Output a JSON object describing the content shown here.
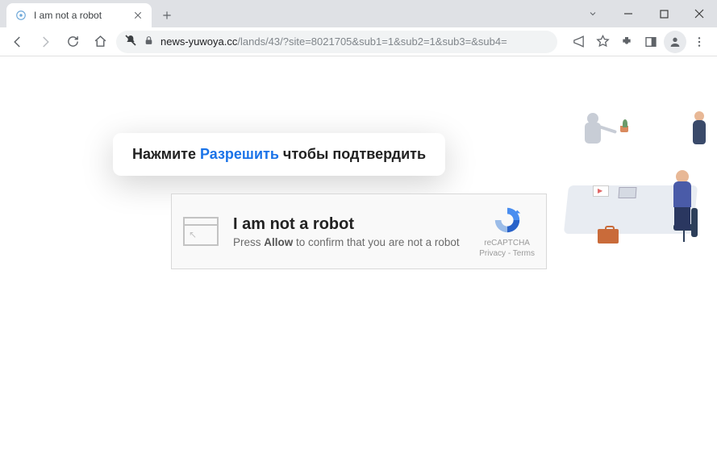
{
  "window": {
    "tab_title": "I am not a robot"
  },
  "toolbar": {
    "url_host": "news-yuwoya.cc",
    "url_rest": "/lands/43/?site=8021705&sub1=1&sub2=1&sub3=&sub4="
  },
  "page": {
    "bubble_prefix": "Нажмите ",
    "bubble_allow": "Разрешить",
    "bubble_suffix": " чтобы подтвердить",
    "rc_title": "I am not a robot",
    "rc_sub_prefix": "Press ",
    "rc_sub_bold": "Allow",
    "rc_sub_suffix": " to confirm that you are not a robot",
    "rc_badge_label": "reCAPTCHA",
    "rc_privacy": "Privacy",
    "rc_dash": " - ",
    "rc_terms": "Terms"
  }
}
